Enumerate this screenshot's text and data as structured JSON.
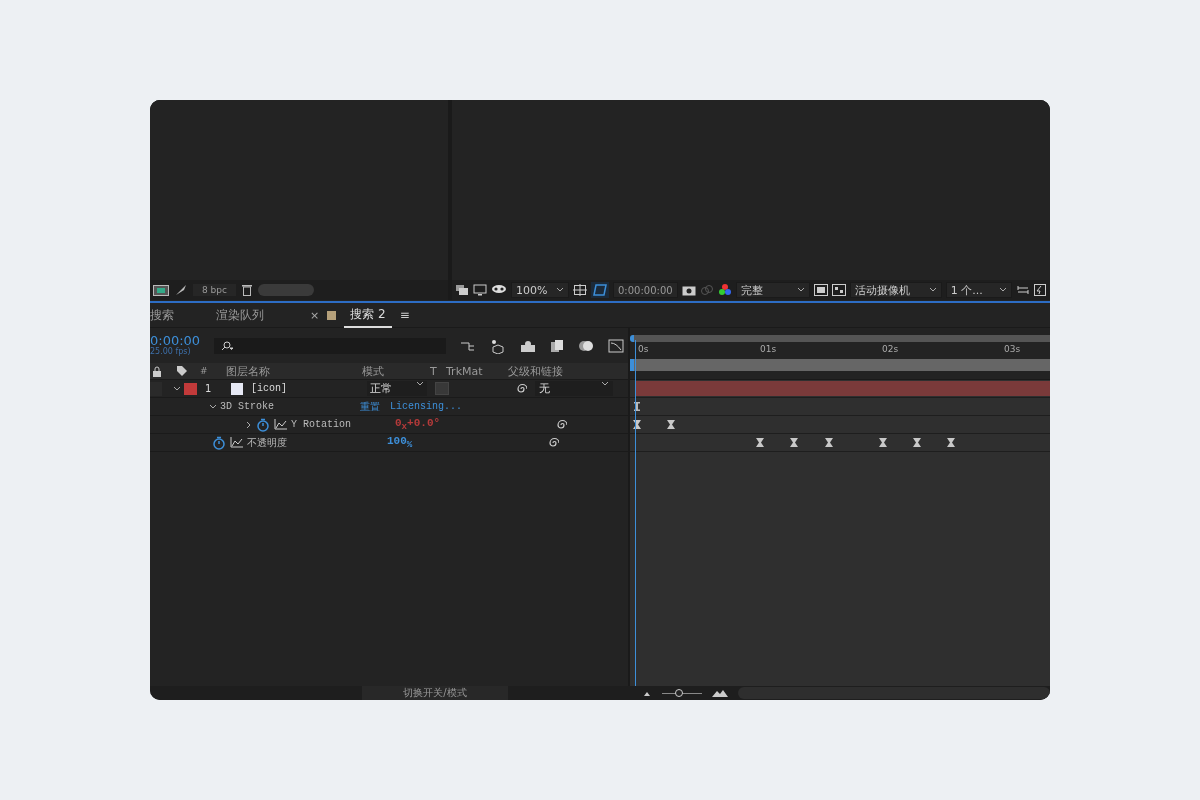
{
  "project_panel": {
    "bit_depth": "8 bpc"
  },
  "viewer": {
    "zoom": "100%",
    "timecode": "0:00:00:00",
    "resolution": "完整",
    "camera": "活动摄像机",
    "views": "1 个..."
  },
  "tabs": [
    {
      "label": "搜索",
      "selected": false
    },
    {
      "label": "渲染队列",
      "selected": false
    },
    {
      "label": "搜索 2",
      "selected": true,
      "close": "×",
      "menu": "≡",
      "color": "#b5a07a"
    }
  ],
  "timeline": {
    "timecode": "0:00:00",
    "fps": "25.00 fps)",
    "columns": [
      "#",
      "图层名称",
      "模式",
      "T",
      "TrkMat",
      "父级和链接"
    ],
    "ruler": [
      "0s",
      "01s",
      "02s",
      "03s"
    ],
    "layers": [
      {
        "number": "1",
        "name": "[icon]",
        "color": "#c23a3a",
        "mode": "正常",
        "parent": "无",
        "expanded": true,
        "children": [
          {
            "kind": "effect",
            "name": "3D Stroke",
            "expanded": true,
            "reset": "重置",
            "licensing": "Licensing...",
            "children": [
              {
                "kind": "property",
                "name": "Y Rotation",
                "expanded": false,
                "value": "0$_{x}$+0.0°",
                "color": "#b53a3a"
              }
            ]
          },
          {
            "kind": "property",
            "name": "不透明度",
            "value": "100$_{%}$",
            "color": "#3d8fd9"
          }
        ]
      }
    ]
  },
  "footer": {
    "toggle": "切换开关/模式",
    "zoom_slider": {
      "level": 0.42
    }
  }
}
